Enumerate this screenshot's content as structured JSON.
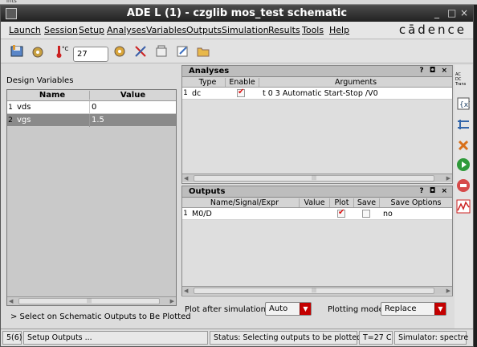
{
  "background_window": {
    "title": "ints"
  },
  "window": {
    "title": "ADE L (1) - czglib mos_test schematic",
    "minimize": "_",
    "restore": "□",
    "close": "×"
  },
  "menu": {
    "items": [
      "Launch",
      "Session",
      "Setup",
      "Analyses",
      "Variables",
      "Outputs",
      "Simulation",
      "Results",
      "Tools",
      "Help"
    ],
    "logo": "cādence"
  },
  "toolbar": {
    "temperature": "27",
    "temp_unit_label": "°C"
  },
  "design_variables": {
    "label": "Design Variables",
    "columns": [
      "Name",
      "Value"
    ],
    "rows": [
      {
        "index": "1",
        "name": "vds",
        "value": "0"
      },
      {
        "index": "2",
        "name": "vgs",
        "value": "1.5"
      }
    ]
  },
  "hint": "> Select on Schematic Outputs to Be Plotted",
  "analyses": {
    "title": "Analyses",
    "controls": "? ◘ ×",
    "columns": [
      "Type",
      "Enable",
      "Arguments"
    ],
    "rows": [
      {
        "index": "1",
        "type": "dc",
        "enabled": true,
        "arguments": "t 0 3 Automatic Start-Stop /V0"
      }
    ]
  },
  "outputs": {
    "title": "Outputs",
    "controls": "? ◘ ×",
    "columns": [
      "Name/Signal/Expr",
      "Value",
      "Plot",
      "Save",
      "Save Options"
    ],
    "rows": [
      {
        "index": "1",
        "name": "M0/D",
        "value": "",
        "plot": true,
        "save": false,
        "save_options": "no"
      }
    ]
  },
  "plot_after": {
    "label": "Plot after simulation:",
    "value": "Auto"
  },
  "plotting_mode": {
    "label": "Plotting mode:",
    "value": "Replace"
  },
  "analysis_types": {
    "ac": "AC",
    "dc": "DC",
    "trans": "Trans"
  },
  "status": {
    "counter": "5(6)",
    "action": "Setup Outputs ...",
    "message": "Status: Selecting outputs to be plotted...",
    "temp": "T=27 C",
    "simulator": "Simulator: spectre"
  },
  "colors": {
    "accent_red": "#d11",
    "selected_row": "#8a8a8a"
  }
}
